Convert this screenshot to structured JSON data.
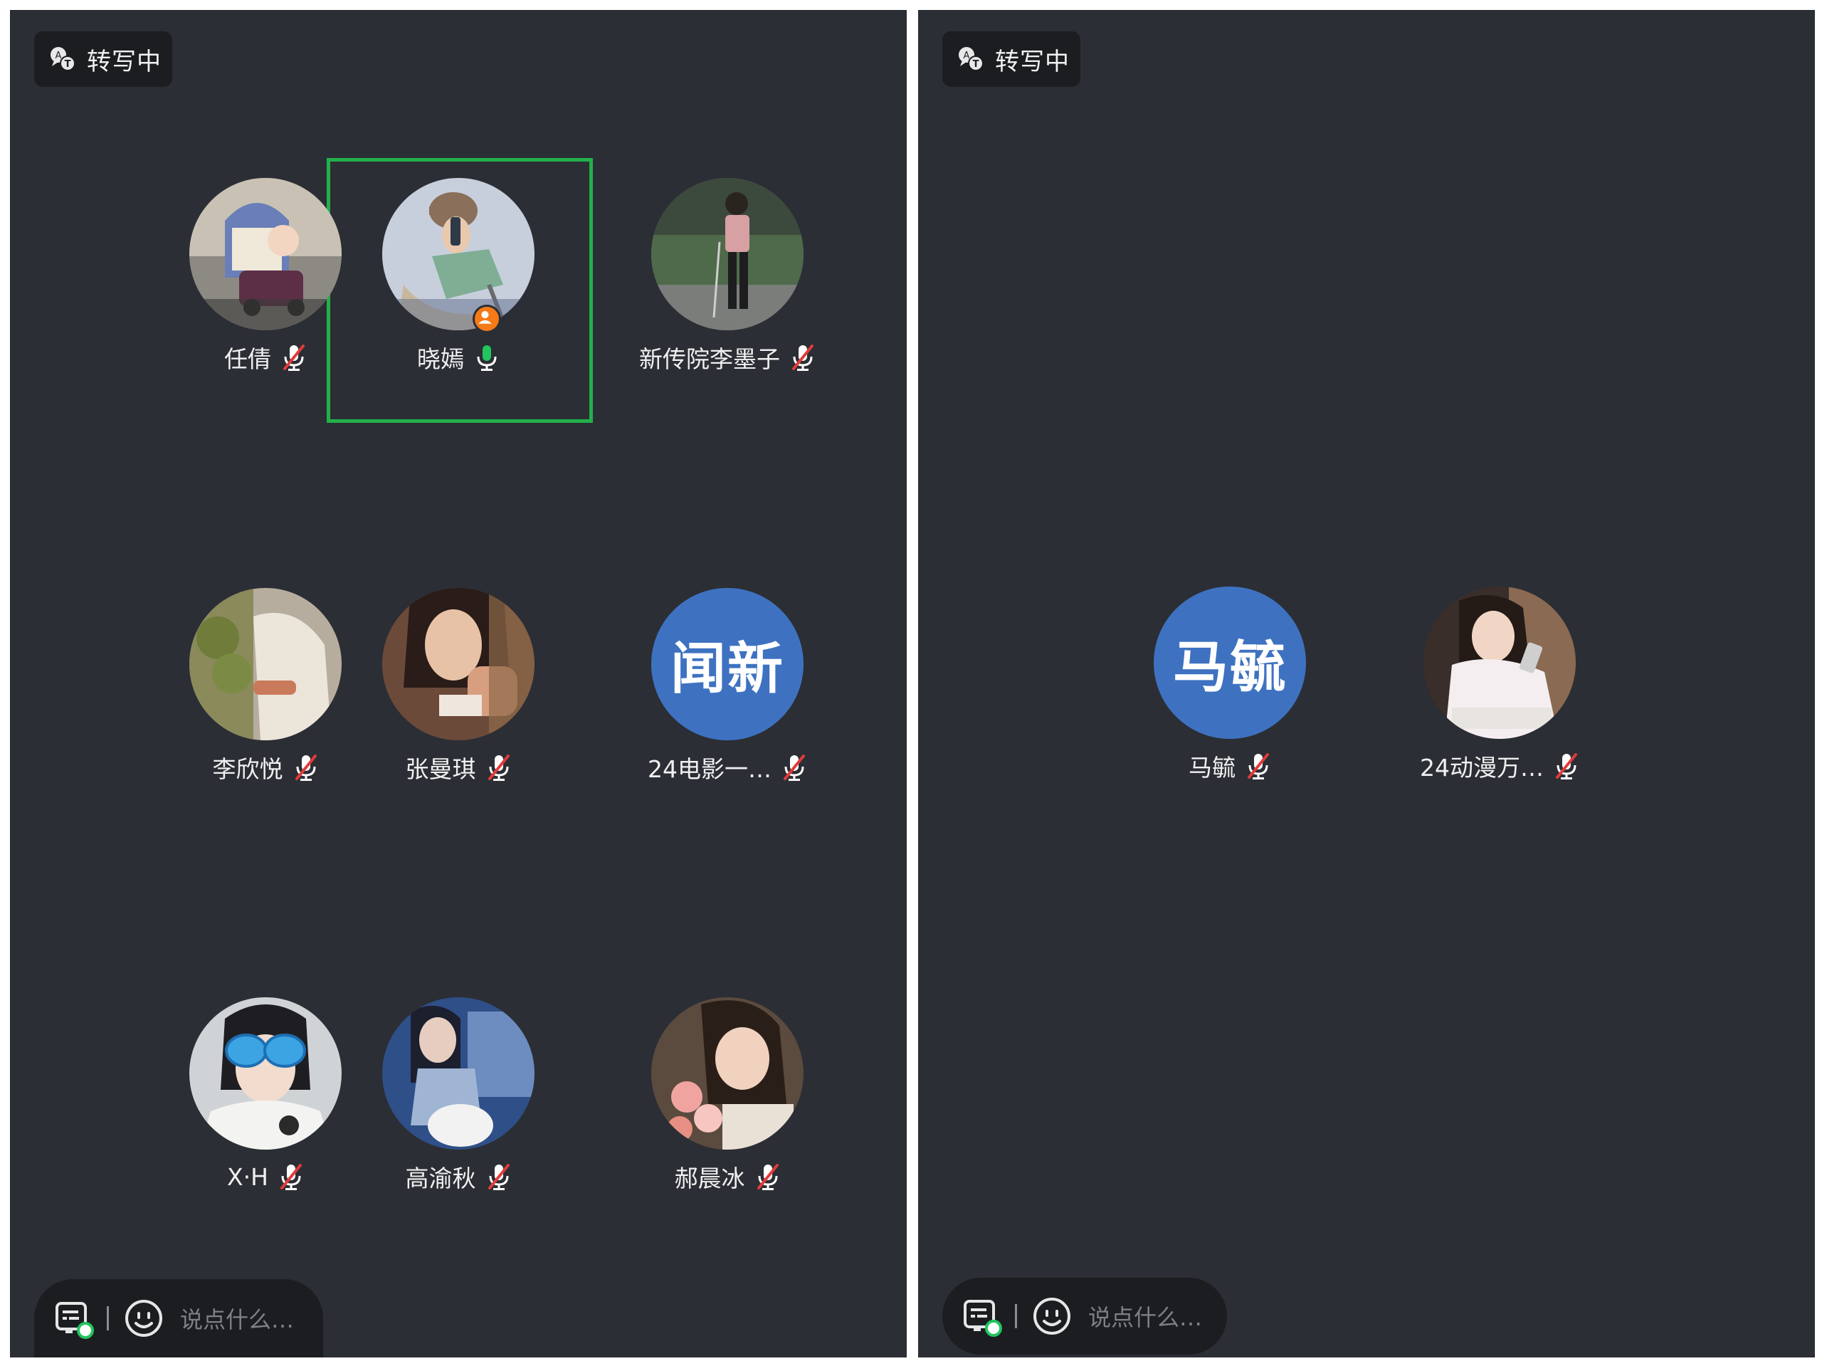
{
  "colors": {
    "panel_bg": "#2b2e34",
    "badge_bg": "#1b1d21",
    "text_avatar_bg": "#3e72c1",
    "speaking_frame": "#22b04b",
    "host_badge": "#f57a18",
    "mic_on": "#22c55e",
    "mic_muted_slash": "#e23b3b"
  },
  "left_panel": {
    "status_badge": {
      "label": "转写中",
      "icon": "transcription-icon"
    },
    "participants": [
      {
        "name": "任倩",
        "mic": "muted",
        "avatar": "photo"
      },
      {
        "name": "晓嫣",
        "mic": "on",
        "avatar": "illustration",
        "speaking": true,
        "host": true
      },
      {
        "name": "新传院李墨子",
        "mic": "muted",
        "avatar": "photo"
      },
      {
        "name": "李欣悦",
        "mic": "muted",
        "avatar": "photo"
      },
      {
        "name": "张曼琪",
        "mic": "muted",
        "avatar": "photo"
      },
      {
        "name": "24电影一…",
        "mic": "muted",
        "avatar": "text",
        "avatar_text": "闻新"
      },
      {
        "name": "X·H",
        "mic": "muted",
        "avatar": "photo"
      },
      {
        "name": "高渝秋",
        "mic": "muted",
        "avatar": "photo"
      },
      {
        "name": "郝晨冰",
        "mic": "muted",
        "avatar": "photo"
      }
    ],
    "comment_bar": {
      "placeholder": "说点什么…",
      "caption_icon": "caption-toggle-icon",
      "emoji_icon": "emoji-icon"
    }
  },
  "right_panel": {
    "status_badge": {
      "label": "转写中",
      "icon": "transcription-icon"
    },
    "participants": [
      {
        "name": "马毓",
        "mic": "muted",
        "avatar": "text",
        "avatar_text": "马毓"
      },
      {
        "name": "24动漫万…",
        "mic": "muted",
        "avatar": "photo"
      }
    ],
    "comment_bar": {
      "placeholder": "说点什么…",
      "caption_icon": "caption-toggle-icon",
      "emoji_icon": "emoji-icon"
    }
  }
}
